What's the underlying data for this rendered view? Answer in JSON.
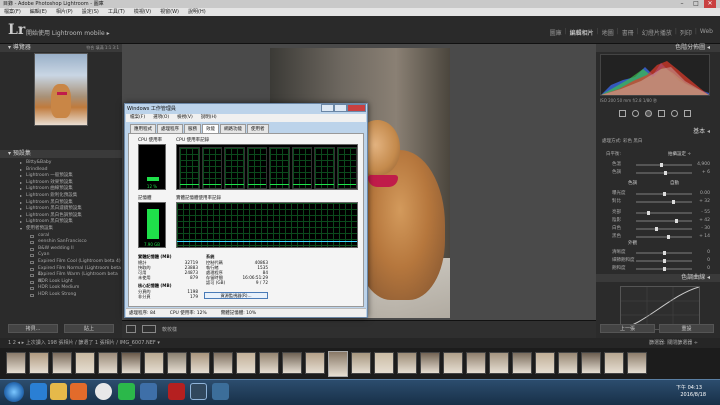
{
  "titlebar": {
    "text": "目錄 - Adobe Photoshop Lightroom - 圖庫",
    "min": "–",
    "max": "□",
    "close": "✕"
  },
  "menubar": [
    "檔案(F)",
    "編輯(E)",
    "相片(P)",
    "設定(S)",
    "工具(T)",
    "檢視(V)",
    "視窗(W)",
    "說明(H)"
  ],
  "identity": {
    "logo": "Lr",
    "mobile_text": "開始使用 Lightroom mobile ▸"
  },
  "modules": {
    "library": "圖庫",
    "develop": "編輯相片",
    "map": "地圖",
    "book": "書冊",
    "slideshow": "幻燈片播放",
    "print": "列印",
    "web": "Web"
  },
  "left": {
    "navigator_title": "導覽器",
    "navigator_zoom": "符合  填滿  1:1  3:1",
    "presets_title": "預設集",
    "presets": [
      {
        "label": "Bitty&Baby",
        "type": "folder"
      },
      {
        "label": "Brindlead",
        "type": "folder"
      },
      {
        "label": "Lightroom 一般預設集",
        "type": "folder"
      },
      {
        "label": "Lightroom 效果預設集",
        "type": "folder"
      },
      {
        "label": "Lightroom 曲線預設集",
        "type": "folder"
      },
      {
        "label": "Lightroom 銳利化預設集",
        "type": "folder"
      },
      {
        "label": "Lightroom 黑白預設集",
        "type": "folder"
      },
      {
        "label": "Lightroom 黑白濾鏡預設集",
        "type": "folder"
      },
      {
        "label": "Lightroom 黑白色調預設集",
        "type": "folder"
      },
      {
        "label": "Lightroom 黑白預設集",
        "type": "folder"
      },
      {
        "label": "使用者預設集",
        "type": "open"
      },
      {
        "label": "coral",
        "type": "leaf"
      },
      {
        "label": "eenshin SanFrancisco",
        "type": "leaf"
      },
      {
        "label": "B&W wedding II",
        "type": "leaf"
      },
      {
        "label": "Cyan",
        "type": "leaf"
      },
      {
        "label": "Expired Film Cool (Lightroom beta 4)",
        "type": "leaf"
      },
      {
        "label": "Expired Film Normal (Lightroom beta 4)",
        "type": "leaf"
      },
      {
        "label": "Expired Film Warm (Lightroom beta 4)",
        "type": "leaf"
      },
      {
        "label": "HDR Look Light",
        "type": "leaf"
      },
      {
        "label": "HDR Look Medium",
        "type": "leaf"
      },
      {
        "label": "HDR Look Strong",
        "type": "leaf"
      }
    ],
    "copy_btn": "拷貝...",
    "paste_btn": "貼上"
  },
  "right": {
    "histogram_title": "色階分佈圖",
    "hist_info": "ISO 200   50 mm   f/2.8   1/80 秒",
    "basic_title": "基本",
    "treatment": "處理方式:  彩色   黑白",
    "wb_label": "白平衡:",
    "wb_value": "拍攝設定 ÷",
    "sliders": [
      {
        "label": "色溫",
        "value": "4,900",
        "pos": 0.45
      },
      {
        "label": "色調",
        "value": "+ 6",
        "pos": 0.52
      },
      {
        "label": "曝光度",
        "value": "0.00",
        "pos": 0.5
      },
      {
        "label": "對比",
        "value": "+ 32",
        "pos": 0.66
      },
      {
        "label": "亮部",
        "value": "- 55",
        "pos": 0.22
      },
      {
        "label": "陰影",
        "value": "+ 42",
        "pos": 0.71
      },
      {
        "label": "白色",
        "value": "- 30",
        "pos": 0.35
      },
      {
        "label": "黑色",
        "value": "+ 14",
        "pos": 0.57
      },
      {
        "label": "清晰度",
        "value": "0",
        "pos": 0.5
      },
      {
        "label": "細節飽和度",
        "value": "0",
        "pos": 0.5
      },
      {
        "label": "飽和度",
        "value": "0",
        "pos": 0.5
      }
    ],
    "tone_label": "色調",
    "auto_label": "自動",
    "presence_label": "外觀",
    "curve_title": "色調曲線",
    "prev_btn": "上一張",
    "reset_btn": "重設"
  },
  "toolbar": {
    "soft_proof": "軟校樣"
  },
  "filmstrip_bar": {
    "left": "1  2  ◂  ▸  上次讀入    198 張相片 / 篩選了 1 張相片 / IMG_6007.NEF ▾",
    "right": "篩選器:  關閉篩選器 ÷"
  },
  "task_manager": {
    "title": "Windows 工作管理員",
    "menu": [
      "檔案(F)",
      "選項(O)",
      "檢視(V)",
      "說明(H)"
    ],
    "tabs": [
      "應用程式",
      "處理程序",
      "服務",
      "效能",
      "網路功能",
      "使用者"
    ],
    "active_tab": "效能",
    "cpu_usage_label": "CPU 使用率",
    "cpu_usage_value": "12 %",
    "cpu_history_label": "CPU 使用率記錄",
    "memory_label": "記憶體",
    "memory_value": "7.90 GB",
    "memory_history_label": "實體記憶體使用率記錄",
    "phys_mem_title": "實體記憶體 (MB)",
    "phys_mem": [
      [
        "總計",
        "32719"
      ],
      [
        "快取的",
        "23883"
      ],
      [
        "可用",
        "24873"
      ],
      [
        "未使用",
        "879"
      ]
    ],
    "kernel_title": "核心記憶體 (MB)",
    "kernel_mem": [
      [
        "分頁的",
        "1198"
      ],
      [
        "非分頁",
        "179"
      ]
    ],
    "system_title": "系統",
    "system": [
      [
        "控制代碼",
        "40863"
      ],
      [
        "執行緒",
        "1535"
      ],
      [
        "處理程序",
        "84"
      ],
      [
        "存留時間",
        "16:06:51:29"
      ],
      [
        "認可 (GB)",
        "9 / 72"
      ]
    ],
    "resmon_btn": "資源監視器(R)...",
    "status": {
      "processes": "處理程序: 84",
      "cpu": "CPU 使用率: 12%",
      "memory": "實體記憶體: 10%"
    }
  },
  "taskbar": {
    "time": "下午 04:13",
    "date": "2016/8/18"
  },
  "colors": {
    "accent": "#d9d9d9",
    "panel": "#2b2b2b",
    "histogram_red": "#e23a2a",
    "histogram_green": "#3ec24a",
    "histogram_blue": "#3b6cf0",
    "graph_green": "#1fe04a"
  }
}
